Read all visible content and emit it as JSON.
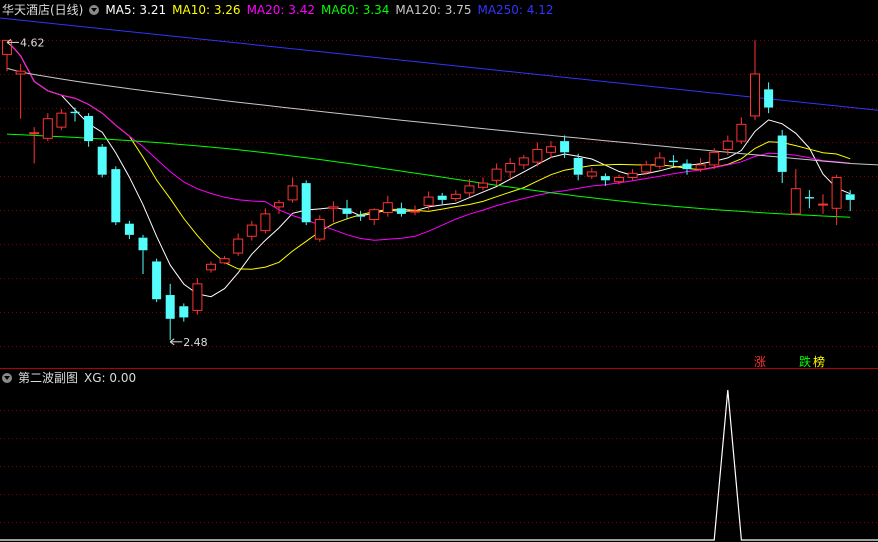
{
  "header": {
    "stock_title": "华天酒店(日线)",
    "ma": [
      {
        "label": "MA5: 3.21",
        "color": "#ffffff"
      },
      {
        "label": "MA10: 3.26",
        "color": "#ffff00"
      },
      {
        "label": "MA20: 3.42",
        "color": "#ff00ff"
      },
      {
        "label": "MA60: 3.34",
        "color": "#00ff00"
      },
      {
        "label": "MA120: 3.75",
        "color": "#c8c8c8"
      },
      {
        "label": "MA250: 4.12",
        "color": "#3333ff"
      }
    ]
  },
  "indicator": {
    "title": "第二波副图",
    "value_label": "XG: 0.00"
  },
  "markers": {
    "rise": "涨",
    "fall": "跌",
    "rank": "榜"
  },
  "colors": {
    "up": "#ff3232",
    "down": "#54fcfc",
    "grid": "#800000"
  },
  "chart_data": [
    {
      "type": "candlestick",
      "title": "华天酒店(日线)",
      "ylim": [
        2.3,
        4.78
      ],
      "annotations": [
        {
          "text": "4.62",
          "value": 4.62,
          "candle": 0
        },
        {
          "text": "2.48",
          "value": 2.48,
          "candle": 12
        }
      ],
      "candles": [
        [
          4.52,
          4.62,
          4.62,
          4.4
        ],
        [
          4.38,
          4.4,
          4.45,
          4.06
        ],
        [
          3.96,
          3.96,
          4.0,
          3.74
        ],
        [
          3.92,
          4.06,
          4.1,
          3.9
        ],
        [
          4.0,
          4.1,
          4.13,
          3.98
        ],
        [
          4.11,
          4.1,
          4.14,
          4.04
        ],
        [
          4.08,
          3.9,
          4.1,
          3.86
        ],
        [
          3.86,
          3.66,
          3.88,
          3.64
        ],
        [
          3.7,
          3.32,
          3.72,
          3.3
        ],
        [
          3.31,
          3.23,
          3.33,
          3.2
        ],
        [
          3.21,
          3.12,
          3.23,
          2.95
        ],
        [
          3.04,
          2.77,
          3.06,
          2.75
        ],
        [
          2.8,
          2.63,
          2.88,
          2.48
        ],
        [
          2.72,
          2.64,
          2.74,
          2.61
        ],
        [
          2.69,
          2.88,
          2.92,
          2.66
        ],
        [
          2.98,
          3.02,
          3.04,
          2.96
        ],
        [
          3.03,
          3.06,
          3.08,
          3.02
        ],
        [
          3.1,
          3.2,
          3.24,
          3.08
        ],
        [
          3.22,
          3.3,
          3.33,
          3.19
        ],
        [
          3.26,
          3.38,
          3.42,
          3.24
        ],
        [
          3.43,
          3.46,
          3.48,
          3.38
        ],
        [
          3.48,
          3.58,
          3.64,
          3.46
        ],
        [
          3.6,
          3.32,
          3.62,
          3.3
        ],
        [
          3.2,
          3.34,
          3.37,
          3.18
        ],
        [
          3.42,
          3.43,
          3.47,
          3.32
        ],
        [
          3.42,
          3.38,
          3.48,
          3.34
        ],
        [
          3.37,
          3.36,
          3.4,
          3.33
        ],
        [
          3.34,
          3.41,
          3.42,
          3.3
        ],
        [
          3.39,
          3.46,
          3.51,
          3.36
        ],
        [
          3.42,
          3.38,
          3.46,
          3.36
        ],
        [
          3.4,
          3.4,
          3.44,
          3.37
        ],
        [
          3.44,
          3.5,
          3.54,
          3.41
        ],
        [
          3.51,
          3.48,
          3.53,
          3.45
        ],
        [
          3.49,
          3.52,
          3.55,
          3.47
        ],
        [
          3.53,
          3.58,
          3.63,
          3.5
        ],
        [
          3.57,
          3.6,
          3.64,
          3.55
        ],
        [
          3.62,
          3.7,
          3.74,
          3.58
        ],
        [
          3.68,
          3.74,
          3.78,
          3.63
        ],
        [
          3.73,
          3.78,
          3.8,
          3.7
        ],
        [
          3.75,
          3.84,
          3.89,
          3.72
        ],
        [
          3.82,
          3.86,
          3.9,
          3.78
        ],
        [
          3.9,
          3.82,
          3.94,
          3.78
        ],
        [
          3.78,
          3.66,
          3.81,
          3.62
        ],
        [
          3.65,
          3.68,
          3.71,
          3.63
        ],
        [
          3.65,
          3.62,
          3.67,
          3.58
        ],
        [
          3.61,
          3.64,
          3.66,
          3.59
        ],
        [
          3.64,
          3.67,
          3.7,
          3.62
        ],
        [
          3.68,
          3.73,
          3.76,
          3.66
        ],
        [
          3.72,
          3.78,
          3.82,
          3.7
        ],
        [
          3.76,
          3.75,
          3.8,
          3.72
        ],
        [
          3.74,
          3.7,
          3.77,
          3.66
        ],
        [
          3.7,
          3.73,
          3.78,
          3.68
        ],
        [
          3.73,
          3.82,
          3.85,
          3.7
        ],
        [
          3.84,
          3.9,
          3.94,
          3.8
        ],
        [
          3.9,
          4.02,
          4.07,
          3.88
        ],
        [
          4.08,
          4.38,
          4.62,
          4.05
        ],
        [
          4.27,
          4.14,
          4.32,
          4.1
        ],
        [
          3.94,
          3.68,
          3.98,
          3.6
        ],
        [
          3.38,
          3.56,
          3.7,
          3.38
        ],
        [
          3.5,
          3.49,
          3.55,
          3.42
        ],
        [
          3.45,
          3.45,
          3.52,
          3.38
        ],
        [
          3.42,
          3.64,
          3.66,
          3.3
        ],
        [
          3.52,
          3.48,
          3.55,
          3.4
        ]
      ]
    },
    {
      "type": "line",
      "title": "第二波副图",
      "series": [
        {
          "name": "XG",
          "x": [
            0,
            52,
            53,
            54,
            62
          ],
          "y": [
            0,
            0,
            1,
            0,
            0
          ]
        }
      ],
      "ylim": [
        0,
        1
      ]
    }
  ]
}
